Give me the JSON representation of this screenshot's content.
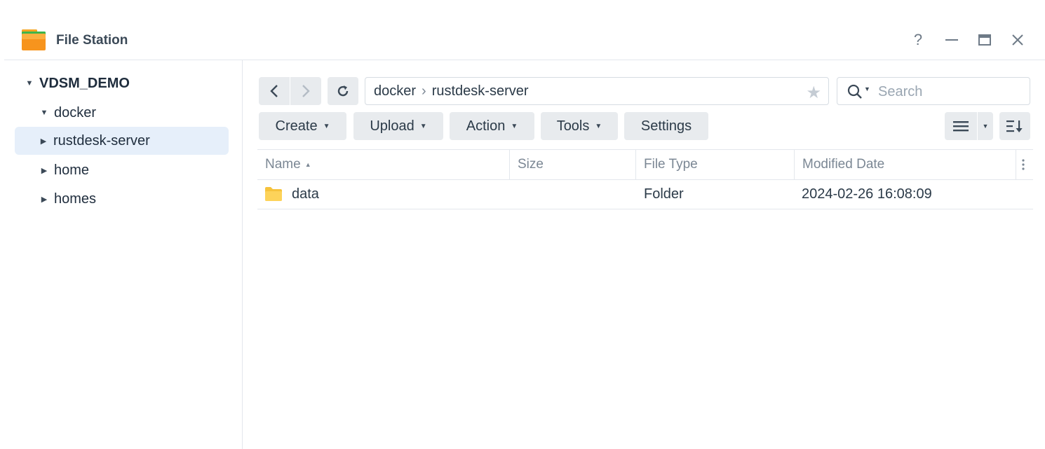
{
  "window": {
    "title": "File Station",
    "controls": {
      "help": "?",
      "minimize": "—",
      "close": "✕"
    }
  },
  "sidebar": {
    "root": "VDSM_DEMO",
    "items": [
      {
        "label": "docker",
        "expanded": true
      },
      {
        "label": "rustdesk-server",
        "selected": true
      },
      {
        "label": "home"
      },
      {
        "label": "homes"
      }
    ]
  },
  "toolbar": {
    "path": [
      "docker",
      "rustdesk-server"
    ],
    "path_separator": "›",
    "search_placeholder": "Search",
    "buttons": {
      "create": "Create",
      "upload": "Upload",
      "action": "Action",
      "tools": "Tools",
      "settings": "Settings"
    }
  },
  "grid": {
    "columns": {
      "name": "Name",
      "size": "Size",
      "type": "File Type",
      "modified": "Modified Date"
    },
    "sort_indicator": "▲",
    "rows": [
      {
        "name": "data",
        "size": "",
        "type": "Folder",
        "modified": "2024-02-26 16:08:09",
        "icon": "folder-icon"
      }
    ]
  },
  "colors": {
    "accent_selected": "#e6effa",
    "folder": "#f6c33c",
    "button_bg": "#e8ebee"
  }
}
